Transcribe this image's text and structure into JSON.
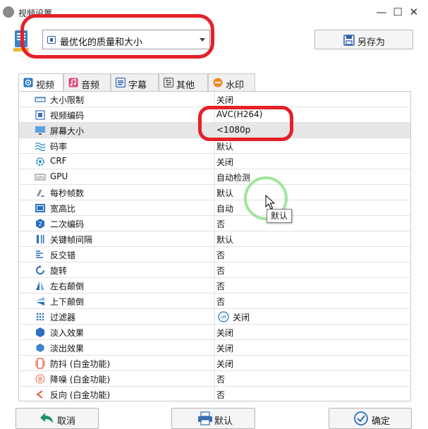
{
  "window": {
    "title": "视频设置",
    "min_glyph": "—",
    "max_glyph": "☐",
    "close_glyph": "✕"
  },
  "preset": {
    "selected": "最优化的质量和大小"
  },
  "save_as": {
    "label": "另存为"
  },
  "tabs": [
    {
      "label": "视频",
      "icon": "video-icon",
      "active": true
    },
    {
      "label": "音频",
      "icon": "music-note-icon"
    },
    {
      "label": "字幕",
      "icon": "subtitle-icon"
    },
    {
      "label": "其他",
      "icon": "settings-sliders-icon"
    },
    {
      "label": "水印",
      "icon": "watermark-icon"
    }
  ],
  "settings": [
    {
      "name": "大小限制",
      "value": "关闭",
      "icon": "ruler-icon"
    },
    {
      "name": "视频编码",
      "value": "AVC(H264)",
      "icon": "chip-icon"
    },
    {
      "name": "屏幕大小",
      "value": "<1080p",
      "icon": "monitor-icon",
      "selected": true
    },
    {
      "name": "码率",
      "value": "默认",
      "icon": "wave-icon"
    },
    {
      "name": "CRF",
      "value": "关闭",
      "icon": "gear-icon"
    },
    {
      "name": "GPU",
      "value": "自动检测",
      "icon": "gpu-icon"
    },
    {
      "name": "每秒帧数",
      "value": "默认",
      "icon": "speed-icon"
    },
    {
      "name": "宽高比",
      "value": "自动",
      "icon": "aspect-icon"
    },
    {
      "name": "二次编码",
      "value": "否",
      "icon": "two-pass-icon"
    },
    {
      "name": "关键帧间隔",
      "value": "默认",
      "icon": "keyframe-icon"
    },
    {
      "name": "反交错",
      "value": "否",
      "icon": "deinterlace-icon"
    },
    {
      "name": "旋转",
      "value": "否",
      "icon": "rotate-icon"
    },
    {
      "name": "左右颠倒",
      "value": "否",
      "icon": "flip-horizontal-icon"
    },
    {
      "name": "上下颠倒",
      "value": "否",
      "icon": "flip-vertical-icon"
    },
    {
      "name": "过滤器",
      "value": "关闭",
      "icon": "filter-icon",
      "value_icon": "off-toggle-icon",
      "value_icon_text": "off"
    },
    {
      "name": "淡入效果",
      "value": "关闭",
      "icon": "fade-in-icon"
    },
    {
      "name": "淡出效果",
      "value": "关闭",
      "icon": "fade-out-icon"
    },
    {
      "name": "防抖 (白金功能)",
      "value": "关闭",
      "icon": "stabilize-icon"
    },
    {
      "name": "降噪 (白金功能)",
      "value": "否",
      "icon": "denoise-icon"
    },
    {
      "name": "反向 (白金功能)",
      "value": "否",
      "icon": "reverse-icon"
    }
  ],
  "tooltip": {
    "text": "默认"
  },
  "footer": {
    "cancel": "取消",
    "default": "默认",
    "ok": "确定"
  },
  "colors": {
    "annotation": "#e5202a",
    "click_ring": "#8fe08a",
    "selected_row": "#e6e6e6",
    "accent_blue": "#2b5fb0"
  }
}
